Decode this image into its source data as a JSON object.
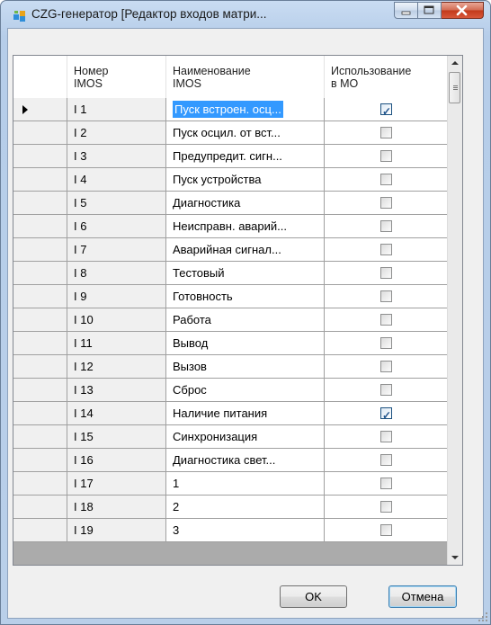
{
  "window": {
    "title": "CZG-генератор [Редактор входов матри..."
  },
  "grid": {
    "headers": {
      "number": "Номер\nIMOS",
      "name": "Наименование\nIMOS",
      "use": "Использование\nв МО"
    },
    "rows": [
      {
        "number": "I 1",
        "name": "Пуск встроен. осц...",
        "use": true,
        "current": true
      },
      {
        "number": "I 2",
        "name": "Пуск осцил. от вст...",
        "use": false
      },
      {
        "number": "I 3",
        "name": "Предупредит. сигн...",
        "use": false
      },
      {
        "number": "I 4",
        "name": "Пуск устройства",
        "use": false
      },
      {
        "number": "I 5",
        "name": "Диагностика",
        "use": false
      },
      {
        "number": "I 6",
        "name": "Неисправн. аварий...",
        "use": false
      },
      {
        "number": "I 7",
        "name": "Аварийная сигнал...",
        "use": false
      },
      {
        "number": "I 8",
        "name": "Тестовый",
        "use": false
      },
      {
        "number": "I 9",
        "name": "Готовность",
        "use": false
      },
      {
        "number": "I 10",
        "name": "Работа",
        "use": false
      },
      {
        "number": "I 11",
        "name": "Вывод",
        "use": false
      },
      {
        "number": "I 12",
        "name": "Вызов",
        "use": false
      },
      {
        "number": "I 13",
        "name": "Сброс",
        "use": false
      },
      {
        "number": "I 14",
        "name": "Наличие питания",
        "use": true
      },
      {
        "number": "I 15",
        "name": "Синхронизация",
        "use": false
      },
      {
        "number": "I 16",
        "name": "Диагностика свет...",
        "use": false
      },
      {
        "number": "I 17",
        "name": "1",
        "use": false
      },
      {
        "number": "I 18",
        "name": "2",
        "use": false
      },
      {
        "number": "I 19",
        "name": "3",
        "use": false
      }
    ]
  },
  "buttons": {
    "ok": "OK",
    "cancel": "Отмена"
  },
  "colors": {
    "selection": "#3399ff",
    "check": "#21558e"
  },
  "icons": {
    "app": "app-icon",
    "minimize": "minimize-icon",
    "maximize": "maximize-icon",
    "close": "close-icon"
  }
}
